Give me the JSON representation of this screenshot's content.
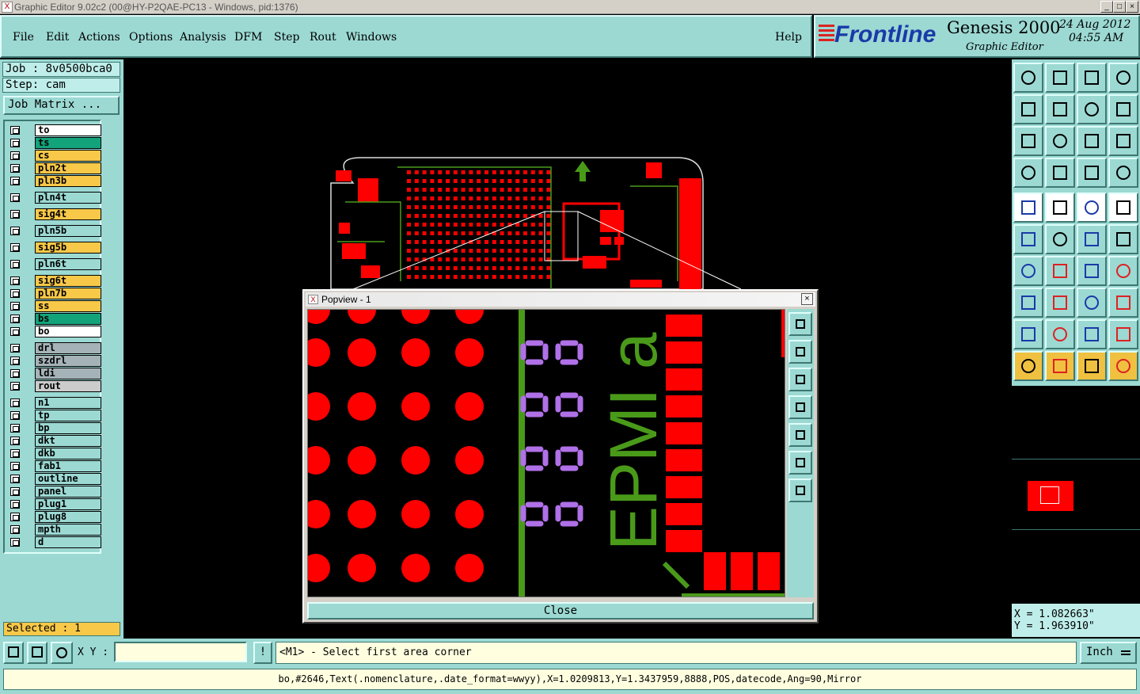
{
  "window": {
    "title": "Graphic Editor 9.02c2 (00@HY-P2QAE-PC13 - Windows, pid:1376)",
    "min": "_",
    "max": "□",
    "close": "×"
  },
  "menu": {
    "items": [
      "File",
      "Edit",
      "Actions",
      "Options",
      "Analysis",
      "DFM",
      "Step",
      "Rout",
      "Windows"
    ],
    "help": "Help"
  },
  "brand": {
    "logo": "Frontline",
    "product": "Genesis 2000",
    "subtitle": "Graphic Editor",
    "date": "24 Aug 2012",
    "time": "04:55 AM"
  },
  "job": {
    "job": "Job : 8v0500bca0",
    "step": "Step: cam",
    "matrix_button": "Job Matrix ..."
  },
  "layers": [
    {
      "name": "to",
      "color": "#ffffff"
    },
    {
      "name": "ts",
      "color": "#13a37a"
    },
    {
      "name": "cs",
      "color": "#f8c848"
    },
    {
      "name": "pln2t",
      "color": "#f8c848"
    },
    {
      "name": "pln3b",
      "color": "#f8c848"
    },
    {
      "name": "pln4t",
      "color": "#9cd9d3"
    },
    {
      "name": "sig4t",
      "color": "#f8c848"
    },
    {
      "name": "pln5b",
      "color": "#9cd9d3"
    },
    {
      "name": "sig5b",
      "color": "#f8c848"
    },
    {
      "name": "pln6t",
      "color": "#9cd9d3"
    },
    {
      "name": "sig6t",
      "color": "#f8c848"
    },
    {
      "name": "pln7b",
      "color": "#f8c848"
    },
    {
      "name": "ss",
      "color": "#f8c848"
    },
    {
      "name": "bs",
      "color": "#13a37a"
    },
    {
      "name": "bo",
      "color": "#ffffff"
    },
    {
      "name": "drl",
      "color": "#a5b3b8"
    },
    {
      "name": "szdrl",
      "color": "#a5b3b8"
    },
    {
      "name": "ldi",
      "color": "#a5b3b8"
    },
    {
      "name": "rout",
      "color": "#cccccc"
    },
    {
      "name": "n1",
      "color": "#9cd9d3"
    },
    {
      "name": "tp",
      "color": "#9cd9d3"
    },
    {
      "name": "bp",
      "color": "#9cd9d3"
    },
    {
      "name": "dkt",
      "color": "#9cd9d3"
    },
    {
      "name": "dkb",
      "color": "#9cd9d3"
    },
    {
      "name": "fab1",
      "color": "#9cd9d3"
    },
    {
      "name": "outline",
      "color": "#9cd9d3"
    },
    {
      "name": "panel",
      "color": "#9cd9d3"
    },
    {
      "name": "plug1",
      "color": "#9cd9d3"
    },
    {
      "name": "plug8",
      "color": "#9cd9d3"
    },
    {
      "name": "mpth",
      "color": "#9cd9d3"
    },
    {
      "name": "d",
      "color": "#9cd9d3"
    }
  ],
  "selected": "Selected : 1",
  "coords": {
    "x": "X = 1.082663\"",
    "y": "Y = 1.963910\""
  },
  "bottom": {
    "xy_label": "X Y :",
    "xy_value": "",
    "prompt": "<M1> - Select first area corner",
    "units": "Inch"
  },
  "status": "bo,#2646,Text(.nomenclature,.date_format=wwyy),X=1.0209813,Y=1.3437959,8888,POS,datecode,Ang=90,Mirror",
  "popup": {
    "title": "Popview - 1",
    "close_label": "Close",
    "silk_text": "EPMI a"
  },
  "colors": {
    "panel": "#9cd9d3",
    "copper": "#ff0000",
    "silk": "#4a9a1a",
    "pad_outline": "#b070e8"
  }
}
